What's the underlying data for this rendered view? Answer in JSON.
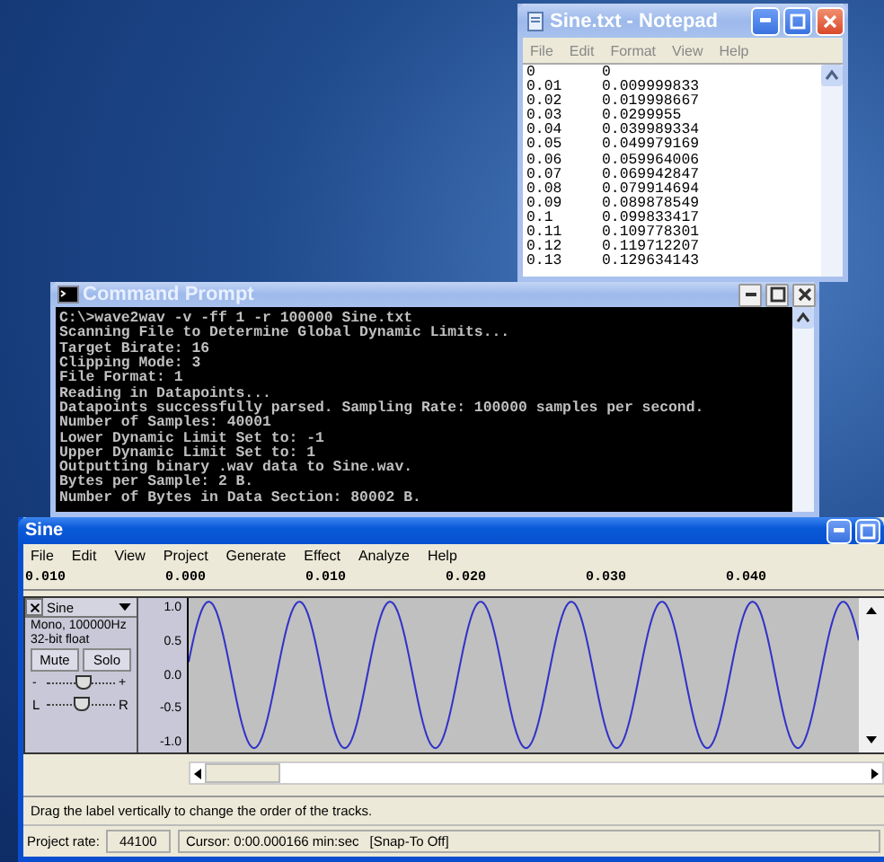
{
  "notepad": {
    "title": "Sine.txt - Notepad",
    "menu": [
      "File",
      "Edit",
      "Format",
      "View",
      "Help"
    ],
    "lines": [
      {
        "column_1": "0",
        "column_2": "0"
      },
      {
        "column_1": "0.01",
        "column_2": "0.009999833"
      },
      {
        "column_1": "0.02",
        "column_2": "0.019998667"
      },
      {
        "column_1": "0.03",
        "column_2": "0.0299955"
      },
      {
        "column_1": "0.04",
        "column_2": "0.039989334"
      },
      {
        "column_1": "0.05",
        "column_2": "0.049979169"
      },
      {
        "column_1": "0.06",
        "column_2": "0.059964006"
      },
      {
        "column_1": "0.07",
        "column_2": "0.069942847"
      },
      {
        "column_1": "0.08",
        "column_2": "0.079914694"
      },
      {
        "column_1": "0.09",
        "column_2": "0.089878549"
      },
      {
        "column_1": "0.1",
        "column_2": "0.099833417"
      },
      {
        "column_1": "0.11",
        "column_2": "0.109778301"
      },
      {
        "column_1": "0.12",
        "column_2": "0.119712207"
      },
      {
        "column_1": "0.13",
        "column_2": "0.129634143"
      }
    ]
  },
  "command_prompt": {
    "title": "Command Prompt",
    "lines": [
      "C:\\>wave2wav -v -ff 1 -r 100000 Sine.txt",
      "Scanning File to Determine Global Dynamic Limits...",
      "Target Birate: 16",
      "Clipping Mode: 3",
      "File Format: 1",
      "Reading in Datapoints...",
      "Datapoints successfully parsed. Sampling Rate: 100000 samples per second.",
      "Number of Samples: 40001",
      "Lower Dynamic Limit Set to: -1",
      "Upper Dynamic Limit Set to: 1",
      "Outputting binary .wav data to Sine.wav.",
      "Bytes per Sample: 2 B.",
      "Number of Bytes in Data Section: 80002 B."
    ]
  },
  "audacity": {
    "title": "Sine",
    "menu": [
      "File",
      "Edit",
      "View",
      "Project",
      "Generate",
      "Effect",
      "Analyze",
      "Help"
    ],
    "ruler": [
      "0.010",
      "0.000",
      "0.010",
      "0.020",
      "0.030",
      "0.040"
    ],
    "track": {
      "name": "Sine",
      "info": [
        "Mono, 100000Hz",
        "32-bit float"
      ],
      "mute": "Mute",
      "solo": "Solo",
      "gain": {
        "minus": "-",
        "plus": "+",
        "level": 0.55
      },
      "pan": {
        "left": "L",
        "right": "R",
        "level": 0.5
      },
      "scale": [
        "1.0",
        "0.5",
        "0.0",
        "-0.5",
        "-1.0"
      ]
    },
    "hint": "Drag the label vertically to change the order of the tracks.",
    "status": {
      "project_rate_label": "Project rate:",
      "project_rate": "44100",
      "cursor": "Cursor: 0:00.000166 min:sec",
      "snap": "[Snap-To Off]"
    }
  }
}
